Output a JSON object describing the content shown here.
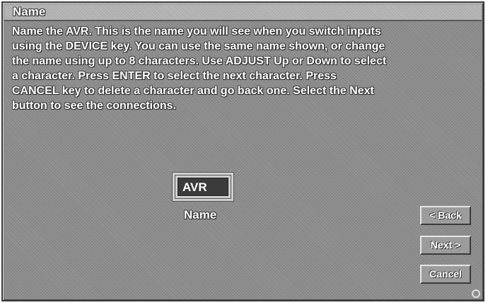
{
  "window": {
    "title": "Name"
  },
  "instructions": "Name the AVR.  This is the name you will see when you switch inputs\nusing the DEVICE key.  You can use the same name shown, or change\nthe name using up to 8 characters. Use ADJUST Up or Down to select\na character.  Press ENTER to select the next character.  Press\nCANCEL key to delete a character and go back one.  Select the Next\nbutton to see the connections.",
  "name_field": {
    "value": "AVR",
    "label": "Name"
  },
  "buttons": {
    "back": "< Back",
    "next": "Next >",
    "cancel": "Cancel"
  },
  "icons": {
    "corner": "status-circle-icon"
  }
}
